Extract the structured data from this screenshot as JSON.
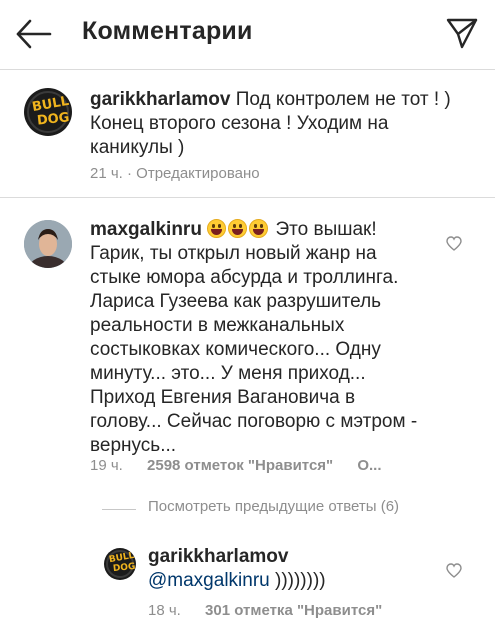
{
  "header": {
    "title": "Комментарии",
    "back_icon": "back-arrow-icon",
    "send_icon": "paper-plane-icon"
  },
  "caption": {
    "username": "garikkharlamov",
    "text_line1": "Под контролем не тот ! )",
    "text_line2": "Конец второго сезона ! Уходим на",
    "text_line3": "каникулы )",
    "time": "21 ч.",
    "edited": "· Отредактировано",
    "avatar_logo_top": "BULL",
    "avatar_logo_bottom": "DOG"
  },
  "comment": {
    "username": "maxgalkinru",
    "emoji_count": 3,
    "line1": "Это вышак!",
    "line2": "Гарик, ты открыл новый жанр на",
    "line3": "стыке юмора абсурда и троллинга.",
    "line4": "Лариса Гузеева как разрушитель",
    "line5": "реальности в межканальных",
    "line6": "состыковках комического... Одну",
    "line7": "минуту... это... У меня приход...",
    "line8": "Приход Евгения Вагановича в",
    "line9": "голову... Сейчас поговорю с мэтром -",
    "line10": "вернусь...",
    "time": "19 ч.",
    "likes": "2598 отметок \"Нравится\"",
    "reply": "О..."
  },
  "view_previous_replies": "Посмотреть предыдущие ответы (6)",
  "reply": {
    "username": "garikkharlamov",
    "mention": "@maxgalkinru",
    "text": " ))))))))",
    "time": "18 ч.",
    "likes": "301 отметка \"Нравится\"",
    "avatar_logo_top": "BULL",
    "avatar_logo_bottom": "DOG"
  },
  "colors": {
    "text": "#262626",
    "muted": "#8e8e8e",
    "mention": "#00376b",
    "divider": "#dbdbdb",
    "logo_yellow": "#f0b41e"
  }
}
